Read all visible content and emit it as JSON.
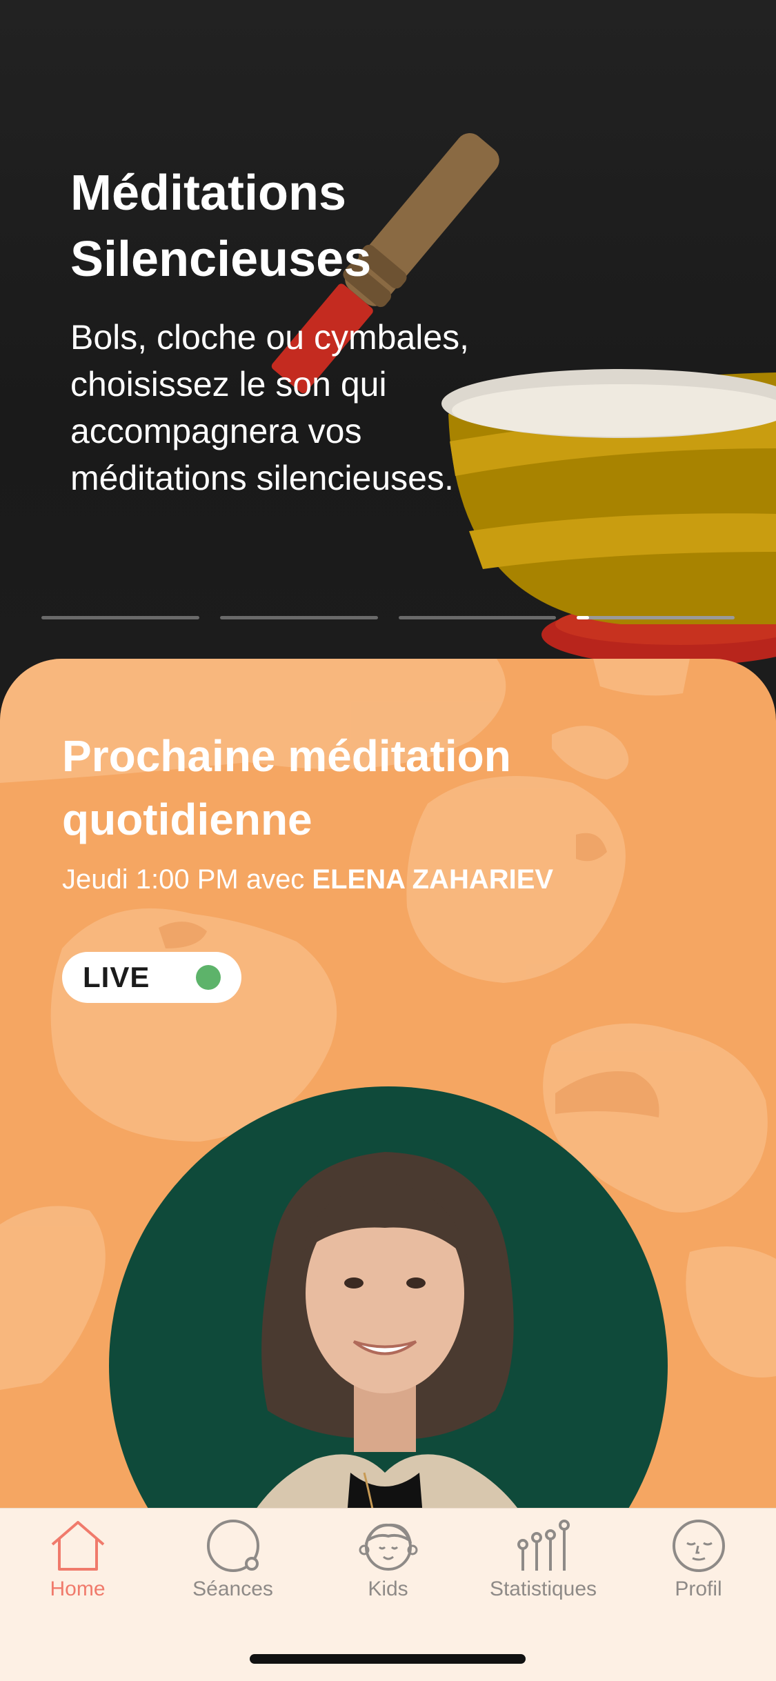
{
  "hero": {
    "title_line1": "Méditations",
    "title_line2": "Silencieuses",
    "description": "Bols, cloche ou cymbales, choisissez le son qui accompagnera vos méditations silencieuses.",
    "pager": {
      "count": 4,
      "active_index": 3
    }
  },
  "card": {
    "title_line1": "Prochaine méditation",
    "title_line2": "quotidienne",
    "schedule": "Jeudi 1:00 PM avec ",
    "host": "ELENA ZAHARIEV",
    "live_label": "LIVE",
    "background_color": "#f5a662"
  },
  "tabbar": {
    "items": [
      {
        "label": "Home",
        "icon": "home-icon",
        "active": true
      },
      {
        "label": "Séances",
        "icon": "sessions-circle-icon",
        "active": false
      },
      {
        "label": "Kids",
        "icon": "kid-face-icon",
        "active": false
      },
      {
        "label": "Statistiques",
        "icon": "stats-icon",
        "active": false
      },
      {
        "label": "Profil",
        "icon": "profile-face-icon",
        "active": false
      }
    ],
    "active_color": "#f07a6b",
    "inactive_color": "#8e8a87"
  }
}
